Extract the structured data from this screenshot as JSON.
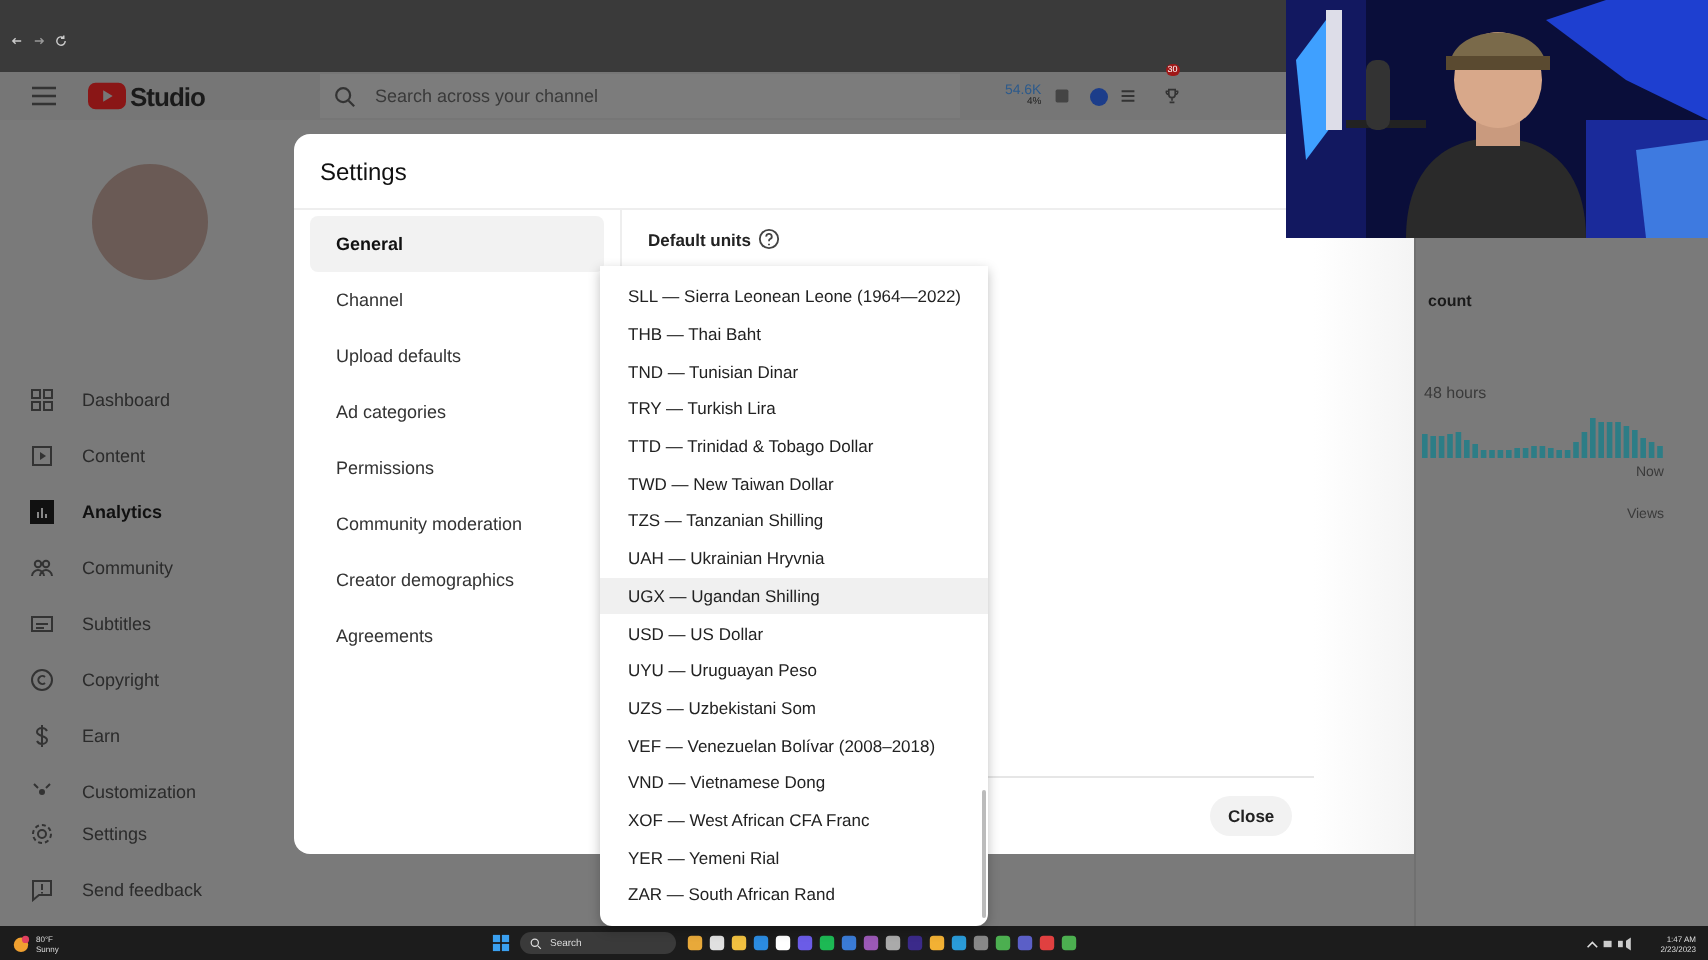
{
  "header": {
    "logo_text": "Studio",
    "search": {
      "placeholder": "Search across your channel"
    },
    "subscribers": "54.6K",
    "subscribers_change": "4%",
    "notification_count": "30"
  },
  "sidebar": {
    "items": [
      {
        "label": "Dashboard",
        "kind": "dashboard",
        "selected": false
      },
      {
        "label": "Content",
        "kind": "content",
        "selected": false
      },
      {
        "label": "Analytics",
        "kind": "analytics",
        "selected": true
      },
      {
        "label": "Community",
        "kind": "community",
        "selected": false
      },
      {
        "label": "Subtitles",
        "kind": "subtitles",
        "selected": false
      },
      {
        "label": "Copyright",
        "kind": "copyright",
        "selected": false
      },
      {
        "label": "Earn",
        "kind": "earn",
        "selected": false
      },
      {
        "label": "Customization",
        "kind": "customization",
        "selected": false
      }
    ],
    "bottom_items": [
      {
        "label": "Settings",
        "kind": "settings"
      },
      {
        "label": "Send feedback",
        "kind": "feedback"
      }
    ]
  },
  "background_panel": {
    "heading": "count",
    "period": "48 hours",
    "axis_label": "Now",
    "metric": "Views"
  },
  "dialog": {
    "title": "Settings",
    "nav": [
      {
        "label": "General",
        "selected": true
      },
      {
        "label": "Channel",
        "selected": false
      },
      {
        "label": "Upload defaults",
        "selected": false
      },
      {
        "label": "Ad categories",
        "selected": false
      },
      {
        "label": "Permissions",
        "selected": false
      },
      {
        "label": "Community moderation",
        "selected": false
      },
      {
        "label": "Creator demographics",
        "selected": false
      },
      {
        "label": "Agreements",
        "selected": false
      }
    ],
    "section_label": "Default units",
    "close_button": "Close"
  },
  "currency_dropdown": {
    "options": [
      {
        "label": "SLL — Sierra Leonean Leone (1964—2022)",
        "hovered": false
      },
      {
        "label": "THB — Thai Baht",
        "hovered": false
      },
      {
        "label": "TND — Tunisian Dinar",
        "hovered": false
      },
      {
        "label": "TRY — Turkish Lira",
        "hovered": false
      },
      {
        "label": "TTD — Trinidad & Tobago Dollar",
        "hovered": false
      },
      {
        "label": "TWD — New Taiwan Dollar",
        "hovered": false
      },
      {
        "label": "TZS — Tanzanian Shilling",
        "hovered": false
      },
      {
        "label": "UAH — Ukrainian Hryvnia",
        "hovered": false
      },
      {
        "label": "UGX — Ugandan Shilling",
        "hovered": true
      },
      {
        "label": "USD — US Dollar",
        "hovered": false
      },
      {
        "label": "UYU — Uruguayan Peso",
        "hovered": false
      },
      {
        "label": "UZS — Uzbekistani Som",
        "hovered": false
      },
      {
        "label": "VEF — Venezuelan Bolívar (2008–2018)",
        "hovered": false
      },
      {
        "label": "VND — Vietnamese Dong",
        "hovered": false
      },
      {
        "label": "XOF — West African CFA Franc",
        "hovered": false
      },
      {
        "label": "YER — Yemeni Rial",
        "hovered": false
      },
      {
        "label": "ZAR — South African Rand",
        "hovered": false
      }
    ]
  },
  "taskbar": {
    "temperature": "80°F",
    "weather": "Sunny",
    "search": "Search",
    "time": "1:47 AM",
    "date": "2/23/2023"
  }
}
